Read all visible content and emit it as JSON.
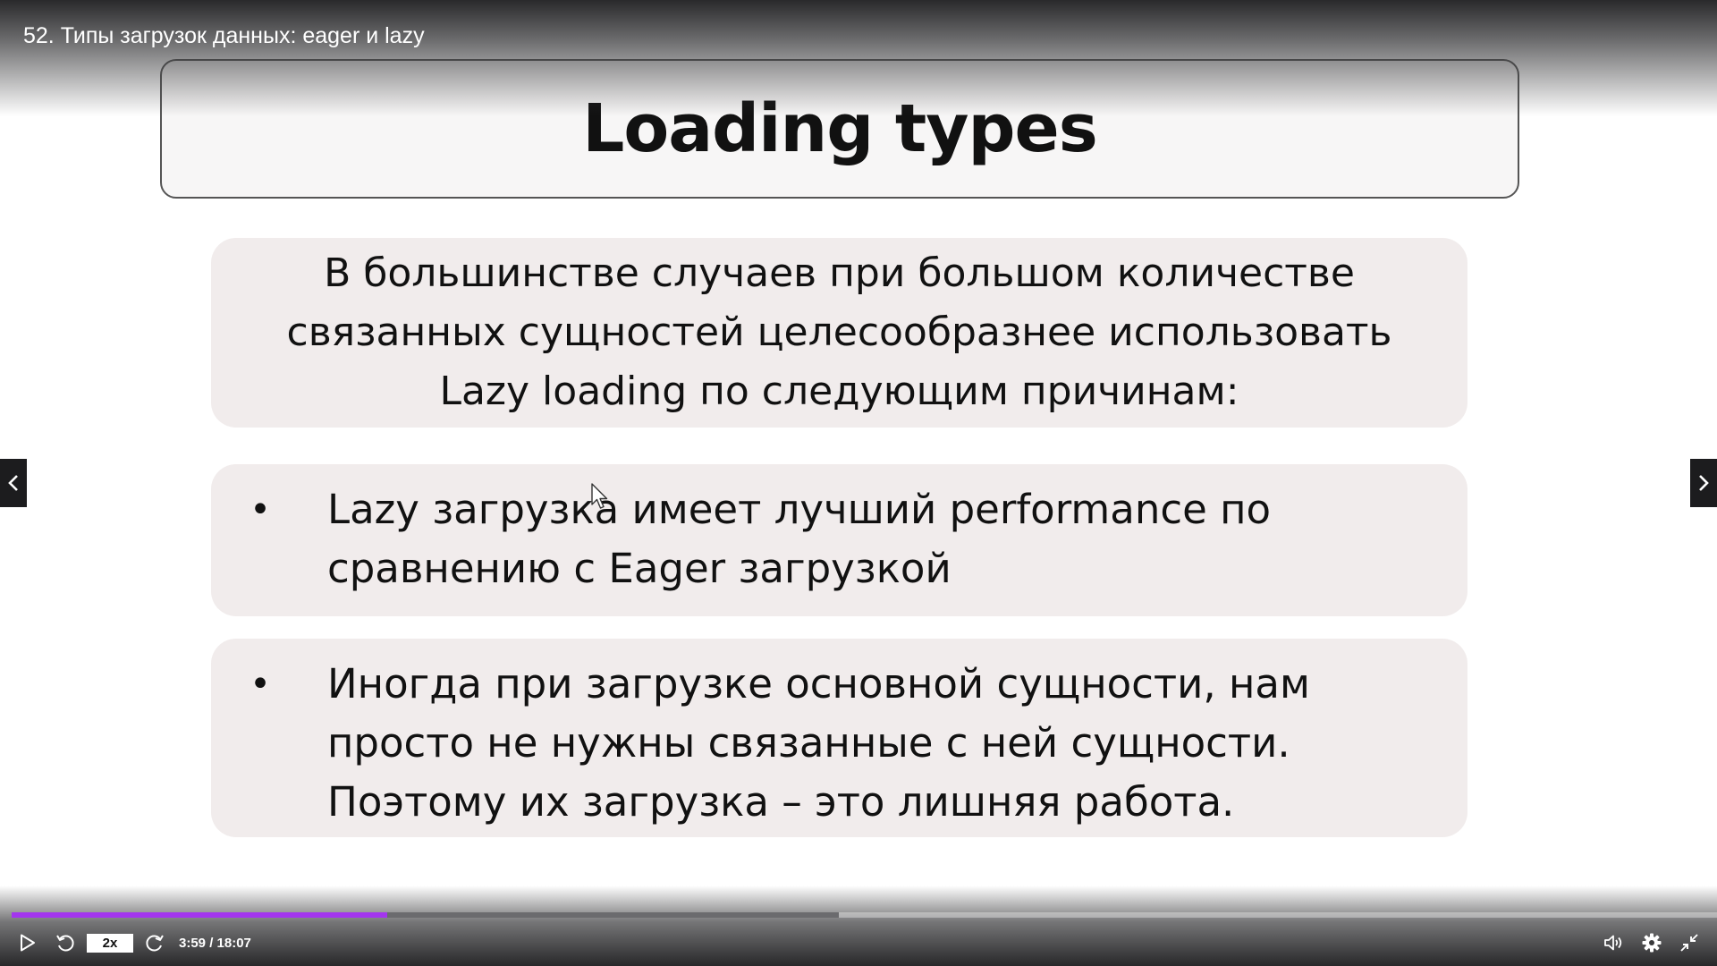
{
  "video": {
    "title": "52. Типы загрузок данных: eager и lazy",
    "progress_played": 0.22,
    "progress_buffered": 0.485
  },
  "slide": {
    "title": "Loading types",
    "intro": "В большинстве случаев при большом количестве связанных сущностей целесообразнее использовать Lazy loading по следующим причинам:",
    "bullets": [
      "Lazy загрузка имеет лучший performance по сравнению с Eager загрузкой",
      "Иногда при загрузке основной сущности, нам просто не нужны связанные с ней сущности. Поэтому их загрузка – это лишняя работа."
    ],
    "bullet_symbol": "•"
  },
  "controls": {
    "speed_label": "2x",
    "time": "3:59 / 18:07",
    "icons": [
      "play-icon",
      "rewind-icon",
      "forward-icon",
      "volume-icon",
      "gear-icon",
      "exit-fullscreen-icon"
    ]
  },
  "navigation": {
    "prev_icon": "chevron-left-icon",
    "next_icon": "chevron-right-icon"
  },
  "colors": {
    "progress_played": "#a335ee",
    "card_background": "#f1ecec"
  }
}
